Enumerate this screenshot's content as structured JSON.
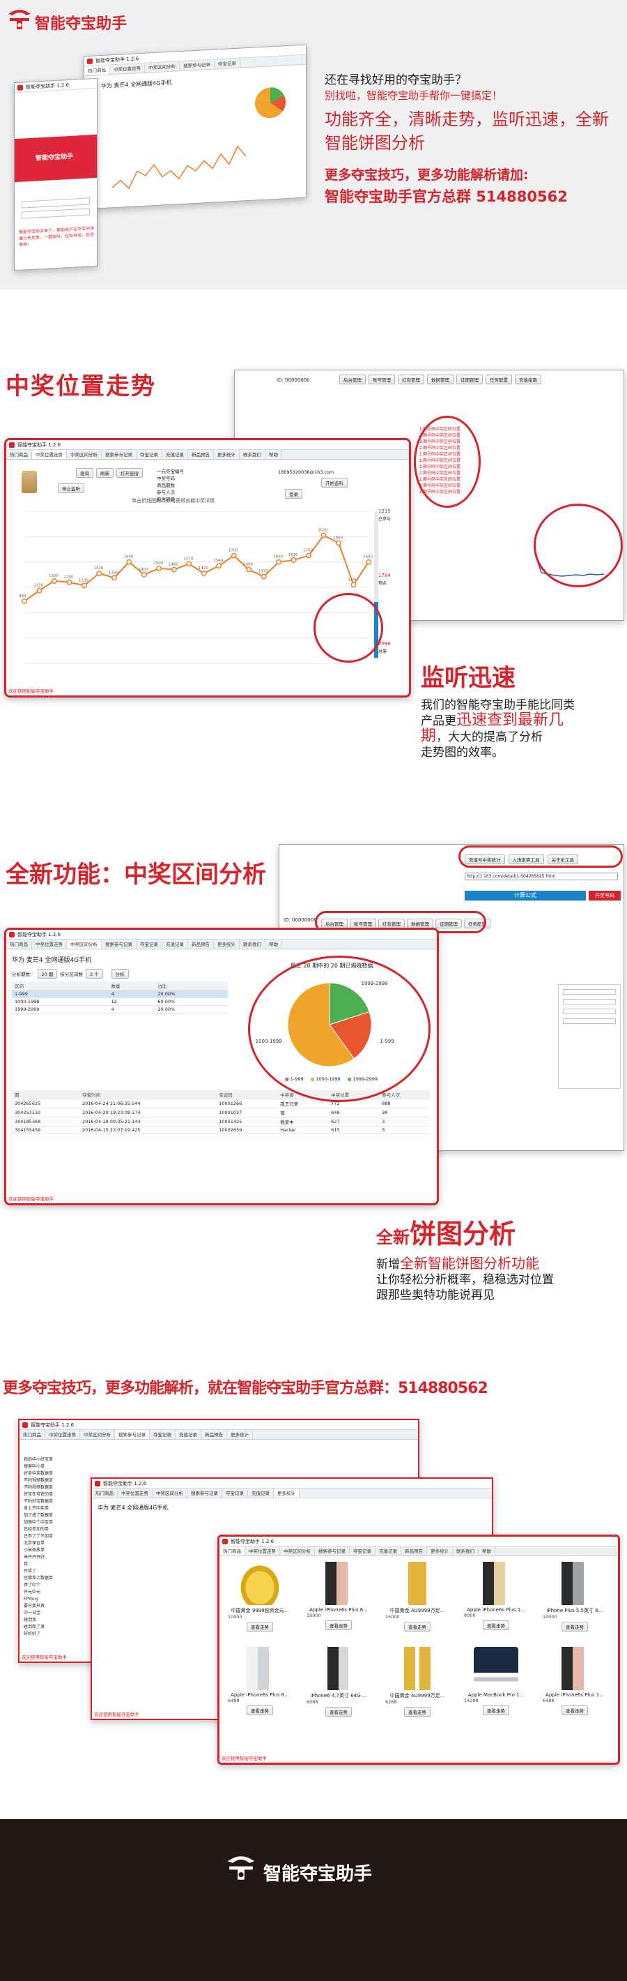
{
  "brand": {
    "name": "智能夺宝助手"
  },
  "hero": {
    "line1": "还在寻找好用的夺宝助手？",
    "line2": "别找啦，智能夺宝助手帮你一键搞定！",
    "line3": "功能齐全，清晰走势，监听迅速，全新智能饼图分析",
    "line4": "更多夺宝技巧，更多功能解析请加:",
    "line5": "智能夺宝助手官方总群 514880562",
    "small_title": "智能夺宝助手 1.2.6",
    "product": "华为 麦芒4 全网通版4G手机",
    "login_brand": "智能夺宝助手",
    "promo_text": "智能夺宝助手来了，帮助用户在夺宝中快速分析走势，一键监听，轻松夺宝，欢迎使用！"
  },
  "sec1": {
    "title": "中奖位置走势",
    "window_title": "智能夺宝助手 1.2.6",
    "tabs": [
      "热门商品",
      "中奖位置走势",
      "中奖区间分析",
      "搜索参与记录",
      "夺宝记录",
      "充值记录",
      "新品预告",
      "更多统计",
      "联系我们",
      "帮助"
    ],
    "labels": {
      "query": "一元夺宝编号",
      "rule": "中奖号码",
      "prize": "商品期数",
      "spent": "参与人次",
      "ref": "最后刷新"
    },
    "buttons": {
      "query": "查询",
      "refresh": "刷新",
      "open": "打开链接",
      "stop": "停止监听",
      "login": "登录",
      "monitor": "开始监听"
    },
    "account": "18695320038@163.com",
    "chart_caption": "单击折线图的点即可获得该期中奖详情",
    "yvals": {
      "top": "1215",
      "top_label": "已参与",
      "mid": "1784",
      "mid_label": "剩余",
      "low": "2999",
      "low_label": "总需"
    },
    "footer_note": "欢迎使用智能夺宝助手",
    "pro_user": "ID: 00000000",
    "pro_menu": [
      "后台管理",
      "账号管理",
      "红包管理",
      "数据管理",
      "征期管理",
      "任务配置",
      "充值指南"
    ],
    "sidebar_items": [
      "上期号码中奖区间位置",
      "上期号码中奖区间位置",
      "上期号码中奖区间位置",
      "上期号码中奖区间位置",
      "上期号码中奖区间位置",
      "上期号码中奖区间位置",
      "上期号码中奖区间位置",
      "上期号码中奖区间位置",
      "上期号码中奖区间位置",
      "上期号码中奖区间位置",
      "上期号码中奖区间位置"
    ],
    "headline": "监听迅速",
    "desc1": "我们的智能夺宝助手能比同类",
    "desc2a": "产品更",
    "desc2b": "迅速查到最新几",
    "desc3a": "期",
    "desc3b": "，大大的提高了分析",
    "desc4": "走势图的效率。"
  },
  "sec2": {
    "title": "全新功能：中奖区间分析",
    "window_title": "智能夺宝助手 1.2.6",
    "tabs": [
      "热门商品",
      "中奖位置走势",
      "中奖区间分析",
      "搜索参与记录",
      "夺宝记录",
      "充值记录",
      "新品预告",
      "更多统计",
      "联系我们",
      "帮助"
    ],
    "product": "华为 麦芒4 全网通版4G手机",
    "select_label": "分析期数：",
    "select_value": "20 期",
    "split_label": "拆分区间数",
    "split_value": "3 个",
    "analyze_btn": "分析",
    "table_head": [
      "区间",
      "数量",
      "占比"
    ],
    "table_rows": [
      [
        "1-999",
        "4",
        "20.00%"
      ],
      [
        "1000-1998",
        "12",
        "60.00%"
      ],
      [
        "1999-2999",
        "4",
        "20.00%"
      ]
    ],
    "pie_title": "最近 20 期中的 20 期已揭晓数据",
    "legend": [
      "1-999",
      "1000-1998",
      "1999-2999"
    ],
    "detail_head": [
      "期",
      "夺宝时间",
      "幸运码",
      "中奖者",
      "中奖位置",
      "参与人次"
    ],
    "detail_rows": [
      [
        "304265625",
        "2016-04-24 21:06:35.544",
        "10001266",
        "孤王归来",
        "772",
        "888"
      ],
      [
        "304253133",
        "2016-04-20 19:23:08.274",
        "10001037",
        "那",
        "648",
        "38"
      ],
      [
        "304185368",
        "2016-04-19 00:35:21.144",
        "10001425",
        "我爱中",
        "627",
        "3"
      ],
      [
        "304155458",
        "2016-04-15 23:07:19.425",
        "10002659",
        "Hacker",
        "615",
        "3"
      ]
    ],
    "footer_note": "欢迎使用智能夺宝助手",
    "top_buttons": [
      "充值与中奖统计",
      "入场走势工具",
      "关于本工具"
    ],
    "top_url": "http://1.163.com/detail/1-304265625.html",
    "calc_label": "计算公式",
    "open_label": "开奖号码",
    "pro_menu": [
      "后台管理",
      "账号管理",
      "红包管理",
      "数据管理",
      "征期管理",
      "任务配置",
      "充值指南"
    ],
    "pro_user": "ID: 00000000",
    "headline_a": "全新",
    "headline_b": "饼图分析",
    "desc1a": "新增",
    "desc1b": "全新智能饼图分析功能",
    "desc2": "让你轻松分析概率，稳稳选对位置",
    "desc3": "跟那些奥特功能说再见"
  },
  "sec3": {
    "title": "更多夺宝技巧，更多功能解析，就在智能夺宝助手官方总群：514880562",
    "window_title": "智能夺宝助手 1.2.6",
    "tabs": [
      "热门商品",
      "中奖位置走势",
      "中奖区间分析",
      "搜索参与记录",
      "夺宝记录",
      "充值记录",
      "新品预告",
      "更多统计",
      "联系我们",
      "帮助"
    ],
    "list_items": [
      "我的中小好宝单",
      "搜索中小单",
      "好单中奖数据单",
      "不利视频数据单",
      "不利视频数据单",
      "好宝在可获的单",
      "不利好宝数据单",
      "身上不中奖单",
      "加了成了数据单",
      "加强中个中宝单",
      "已经参加的单",
      "已参了了不加单",
      "北京保证单",
      "小米奔放单",
      "米开开开好",
      "我",
      "开奖了",
      "巴黎和上数据单",
      "停了中个",
      "开元中元",
      "FPYong",
      "要开卖开具",
      "中一日宝",
      "碰到我",
      "碰到和了发",
      "好好好了"
    ],
    "back_product": "华为 麦芒4 全网通版4G手机",
    "products": [
      {
        "name": "中国黄金 9999投资金元...",
        "price": "10000",
        "btn": "查看走势",
        "kind": "gold"
      },
      {
        "name": "Apple iPhone6s Plus 6...",
        "price": "10000",
        "btn": "查看走势",
        "kind": "phone-rose"
      },
      {
        "name": "中国黄金 AU9999万足...",
        "price": "15000",
        "btn": "查看走势",
        "kind": "goldbar"
      },
      {
        "name": "Apple iPhone6s Plus 1...",
        "price": "8000",
        "btn": "查看走势",
        "kind": "phone-gold"
      },
      {
        "name": "iPhone Plus 5.5英寸 6...",
        "price": "10000",
        "btn": "查看走势",
        "kind": "phone-gray"
      },
      {
        "name": "Apple iPhone6s Plus 6...",
        "price": "6488",
        "btn": "查看走势",
        "kind": "phone-silver"
      },
      {
        "name": "iPhone6 4.7英寸 64G ...",
        "price": "6088",
        "btn": "查看走势",
        "kind": "phone-silver2"
      },
      {
        "name": "中国黄金 AU9999万足...",
        "price": "6288",
        "btn": "查看走势",
        "kind": "goldbar2"
      },
      {
        "name": "Apple MacBook Pro 1...",
        "price": "14288",
        "btn": "查看走势",
        "kind": "laptop"
      },
      {
        "name": "Apple iPhone6s Plus 1...",
        "price": "6488",
        "btn": "查看走势",
        "kind": "phone-rose2"
      }
    ],
    "footer_note": "欢迎使用智能夺宝助手"
  },
  "footer": {
    "brand": "智能夺宝助手"
  },
  "colors": {
    "accent": "#d8232a",
    "orange": "#ef7d22",
    "green": "#4caf50",
    "footer_bg": "#231816"
  },
  "chart_data": [
    {
      "type": "line",
      "title": "单击折线图的点即可获得该期中奖详情",
      "values": [
        980,
        1150,
        1300,
        1280,
        1230,
        1420,
        1350,
        1600,
        1400,
        1500,
        1480,
        1570,
        1420,
        1540,
        1700,
        1480,
        1370,
        1600,
        1630,
        1700,
        2020,
        1900,
        1240,
        1600
      ],
      "ylim": [
        0,
        2400
      ],
      "color": "#ef7d22"
    },
    {
      "type": "pie",
      "title": "最近 20 期中的 20 期已揭晓数据",
      "categories": [
        "1-999",
        "1000-1998",
        "1999-2999"
      ],
      "values": [
        4,
        12,
        4
      ],
      "colors": [
        "#e8552e",
        "#f0a52a",
        "#4caf50"
      ]
    }
  ]
}
